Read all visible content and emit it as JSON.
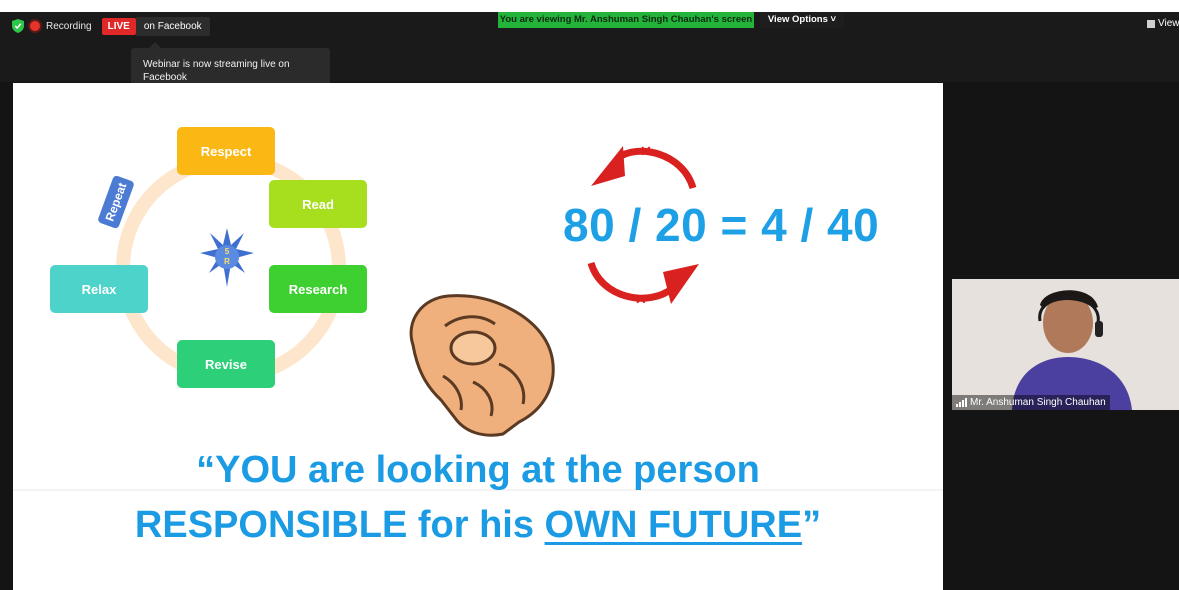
{
  "meeting": {
    "recording_label": "Recording",
    "live_badge": "LIVE",
    "live_platform": "on Facebook",
    "tooltip": "Webinar is now streaming live on Facebook",
    "viewing_banner": "You are viewing Mr. Anshuman Singh Chauhan's screen",
    "view_options_label": "View Options",
    "view_label": "View",
    "status_colors": {
      "live": "#e02828",
      "banner": "#23b33a"
    }
  },
  "slide": {
    "cycle": {
      "center_label_top": "5",
      "center_label_bottom": "R",
      "steps": [
        {
          "label": "Respect",
          "color": "#fbb714"
        },
        {
          "label": "Read",
          "color": "#a7df1e"
        },
        {
          "label": "Research",
          "color": "#3ecf31"
        },
        {
          "label": "Revise",
          "color": "#2ecf79"
        },
        {
          "label": "Relax",
          "color": "#4dd3c9"
        }
      ],
      "repeat_label": "Repeat"
    },
    "equation": "80 / 20 = 4 / 40",
    "quote_line1": "“YOU are looking at the person",
    "quote_line2_prefix": "RESPONSIBLE for his ",
    "quote_line2_underlined": "OWN FUTURE",
    "quote_line2_suffix": "”"
  },
  "participant": {
    "name": "Mr. Anshuman Singh Chauhan"
  }
}
